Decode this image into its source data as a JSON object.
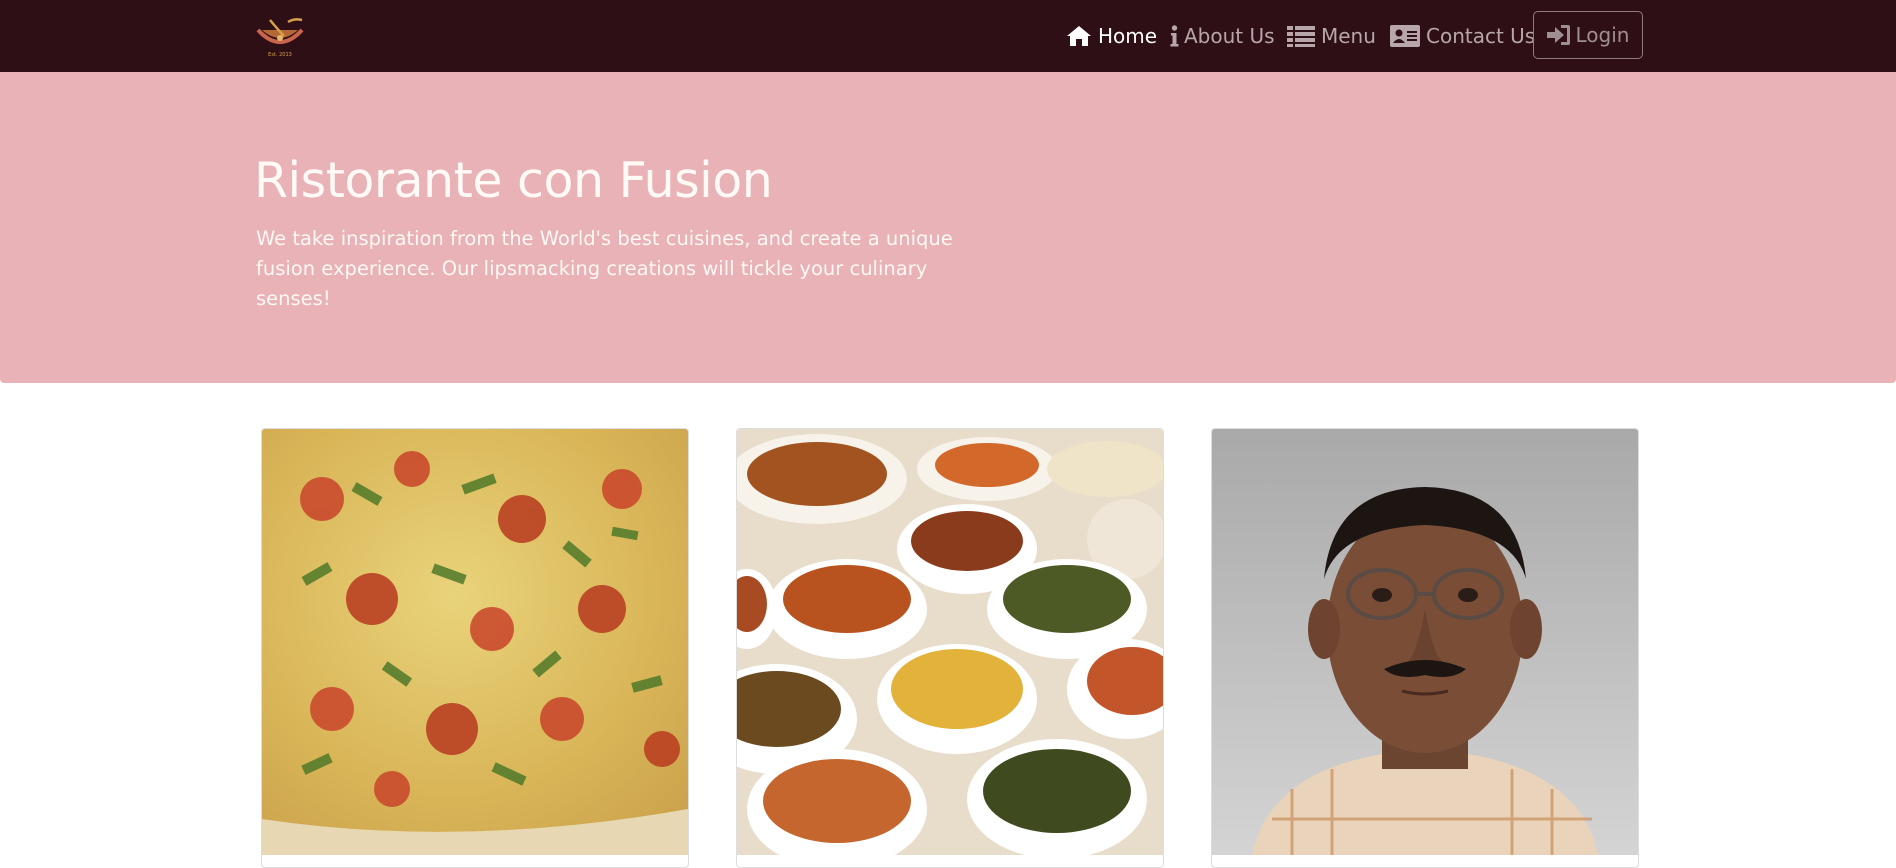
{
  "brand": {
    "logo_alt": "Ristorante Con Fusion",
    "logo_caption": "Est. 2013"
  },
  "nav": {
    "items": [
      {
        "label": "Home",
        "icon": "home-icon",
        "active": true
      },
      {
        "label": "About Us",
        "icon": "info-icon",
        "active": false
      },
      {
        "label": "Menu",
        "icon": "list-icon",
        "active": false
      },
      {
        "label": "Contact Us",
        "icon": "address-card-icon",
        "active": false
      }
    ],
    "login_label": "Login"
  },
  "jumbotron": {
    "title": "Ristorante con Fusion",
    "text": "We take inspiration from the World's best cuisines, and create a unique fusion experience. Our lipsmacking creations will tickle your culinary senses!"
  },
  "cards": [
    {
      "image": "pizza-photo"
    },
    {
      "image": "buffet-photo"
    },
    {
      "image": "chef-portrait-photo"
    }
  ],
  "colors": {
    "navbar": "#2d0f15",
    "jumbotron": "#e8b2b6",
    "nav_active": "#ffffff",
    "nav_inactive": "#b7a7aa"
  }
}
